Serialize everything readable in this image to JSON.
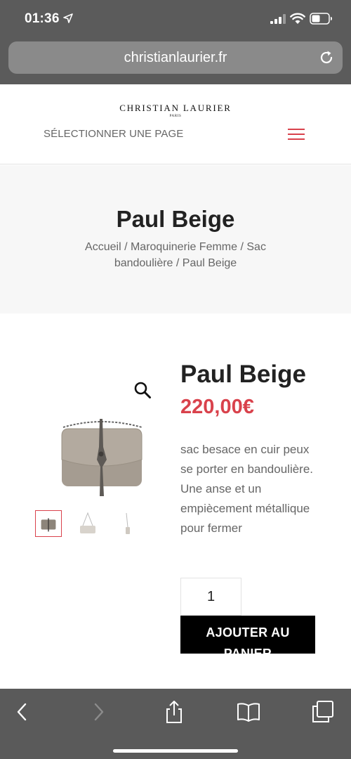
{
  "status_bar": {
    "time": "01:36"
  },
  "browser": {
    "url": "christianlaurier.fr"
  },
  "site": {
    "logo_main": "CHRISTIAN LAURIER",
    "logo_sub": "PARIS",
    "nav_select_label": "SÉLECTIONNER UNE PAGE"
  },
  "page": {
    "title": "Paul Beige",
    "breadcrumb": {
      "home": "Accueil",
      "sep": " / ",
      "category": "Maroquinerie Femme",
      "subcategory": "Sac bandoulière",
      "current": "Paul Beige"
    }
  },
  "product": {
    "name": "Paul Beige",
    "price": "220,00€",
    "description": "sac besace en cuir peux se porter en bandoulière. Une anse et un empiècement métallique pour fermer",
    "quantity": "1",
    "add_to_cart_label": "AJOUTER AU PANIER",
    "thumbnails": [
      "bag-front",
      "bag-strap",
      "bag-side"
    ]
  },
  "colors": {
    "accent": "#d9424c",
    "browser_chrome": "#5b5b5b",
    "title_band": "#f7f7f7",
    "button": "#000000"
  },
  "icons": {
    "zoom": "magnifier-icon",
    "menu": "hamburger-icon",
    "reload": "reload-icon",
    "back": "chevron-left-icon",
    "forward": "chevron-right-icon",
    "share": "share-icon",
    "bookmarks": "book-icon",
    "tabs": "tabs-icon"
  }
}
